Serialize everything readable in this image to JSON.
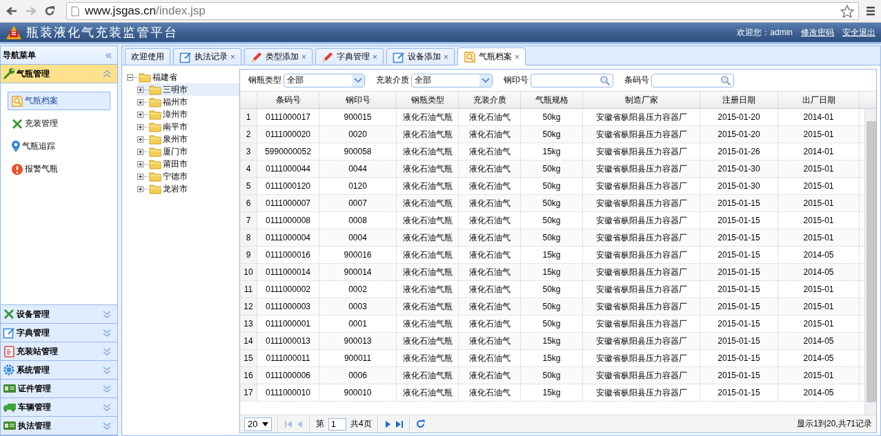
{
  "browser": {
    "url_host": "www.jsgas.cn",
    "url_path": "/index.jsp"
  },
  "header": {
    "title": "瓶装液化气充装监管平台",
    "welcome": "欢迎您：admin",
    "links": [
      "修改密码",
      "安全退出"
    ]
  },
  "sidebar": {
    "title": "导航菜单",
    "collapse": "«",
    "sections": [
      {
        "label": "气瓶管理",
        "expanded": true,
        "items": [
          {
            "label": "气瓶档案",
            "selected": true
          },
          {
            "label": "充装管理",
            "selected": false
          },
          {
            "label": "气瓶追踪",
            "selected": false
          },
          {
            "label": "报警气瓶",
            "selected": false
          }
        ]
      },
      {
        "label": "设备管理",
        "expanded": false
      },
      {
        "label": "字典管理",
        "expanded": false
      },
      {
        "label": "充装站管理",
        "expanded": false
      },
      {
        "label": "系统管理",
        "expanded": false
      },
      {
        "label": "证件管理",
        "expanded": false
      },
      {
        "label": "车辆管理",
        "expanded": false
      },
      {
        "label": "执法管理",
        "expanded": false
      }
    ]
  },
  "tabs": [
    {
      "label": "欢迎使用",
      "selected": false
    },
    {
      "label": "执法记录",
      "close": "×",
      "selected": false
    },
    {
      "label": "类型添加",
      "close": "×",
      "selected": false
    },
    {
      "label": "字典管理",
      "close": "×",
      "selected": false
    },
    {
      "label": "设备添加",
      "close": "×",
      "selected": false
    },
    {
      "label": "气瓶档案",
      "close": "×",
      "selected": true
    }
  ],
  "tree": {
    "label": "福建省",
    "expanded": true,
    "children": [
      {
        "label": "三明市",
        "expanded": false,
        "selected": true
      },
      {
        "label": "福州市",
        "expanded": false,
        "selected": false
      },
      {
        "label": "漳州市",
        "expanded": false,
        "selected": false
      },
      {
        "label": "南平市",
        "expanded": false,
        "selected": false
      },
      {
        "label": "泉州市",
        "expanded": false,
        "selected": false
      },
      {
        "label": "厦门市",
        "expanded": false,
        "selected": false
      },
      {
        "label": "莆田市",
        "expanded": false,
        "selected": false
      },
      {
        "label": "宁德市",
        "expanded": false,
        "selected": false
      },
      {
        "label": "龙岩市",
        "expanded": false,
        "selected": false
      }
    ]
  },
  "filters": [
    {
      "kind": "select",
      "label": "钢瓶类型",
      "value": "全部"
    },
    {
      "kind": "select",
      "label": "充装介质",
      "value": "全部"
    },
    {
      "kind": "search",
      "label": "钢印号"
    },
    {
      "kind": "search",
      "label": "条码号"
    }
  ],
  "table": {
    "columns": [
      "条码号",
      "钢印号",
      "钢瓶类型",
      "充装介质",
      "气瓶规格",
      "制造厂家",
      "注册日期",
      "出厂日期"
    ],
    "rows": [
      {
        "n": "1",
        "cells": [
          "0111000017",
          "900015",
          "液化石油气瓶",
          "液化石油气",
          "50kg",
          "安徽省枞阳县压力容器厂",
          "2015-01-20",
          "2014-01"
        ]
      },
      {
        "n": "2",
        "cells": [
          "0111000020",
          "0020",
          "液化石油气瓶",
          "液化石油气",
          "50kg",
          "安徽省枞阳县压力容器厂",
          "2015-01-20",
          "2015-01"
        ]
      },
      {
        "n": "3",
        "cells": [
          "5990000052",
          "900058",
          "液化石油气瓶",
          "液化石油气",
          "15kg",
          "安徽省枞阳县压力容器厂",
          "2015-01-26",
          "2014-01"
        ]
      },
      {
        "n": "4",
        "cells": [
          "0111000044",
          "0044",
          "液化石油气瓶",
          "液化石油气",
          "50kg",
          "安徽省枞阳县压力容器厂",
          "2015-01-30",
          "2015-01"
        ]
      },
      {
        "n": "5",
        "cells": [
          "0111000120",
          "0120",
          "液化石油气瓶",
          "液化石油气",
          "50kg",
          "安徽省枞阳县压力容器厂",
          "2015-01-30",
          "2015-01"
        ]
      },
      {
        "n": "6",
        "cells": [
          "0111000007",
          "0007",
          "液化石油气瓶",
          "液化石油气",
          "50kg",
          "安徽省枞阳县压力容器厂",
          "2015-01-15",
          "2015-01"
        ]
      },
      {
        "n": "7",
        "cells": [
          "0111000008",
          "0008",
          "液化石油气瓶",
          "液化石油气",
          "50kg",
          "安徽省枞阳县压力容器厂",
          "2015-01-15",
          "2015-01"
        ]
      },
      {
        "n": "8",
        "cells": [
          "0111000004",
          "0004",
          "液化石油气瓶",
          "液化石油气",
          "50kg",
          "安徽省枞阳县压力容器厂",
          "2015-01-15",
          "2015-01"
        ]
      },
      {
        "n": "9",
        "cells": [
          "0111000016",
          "900016",
          "液化石油气瓶",
          "液化石油气",
          "15kg",
          "安徽省枞阳县压力容器厂",
          "2015-01-15",
          "2014-05"
        ]
      },
      {
        "n": "10",
        "cells": [
          "0111000014",
          "900014",
          "液化石油气瓶",
          "液化石油气",
          "15kg",
          "安徽省枞阳县压力容器厂",
          "2015-01-15",
          "2014-05"
        ]
      },
      {
        "n": "11",
        "cells": [
          "0111000002",
          "0002",
          "液化石油气瓶",
          "液化石油气",
          "50kg",
          "安徽省枞阳县压力容器厂",
          "2015-01-15",
          "2015-01"
        ]
      },
      {
        "n": "12",
        "cells": [
          "0111000003",
          "0003",
          "液化石油气瓶",
          "液化石油气",
          "50kg",
          "安徽省枞阳县压力容器厂",
          "2015-01-15",
          "2015-01"
        ]
      },
      {
        "n": "13",
        "cells": [
          "0111000001",
          "0001",
          "液化石油气瓶",
          "液化石油气",
          "50kg",
          "安徽省枞阳县压力容器厂",
          "2015-01-15",
          "2015-01"
        ]
      },
      {
        "n": "14",
        "cells": [
          "0111000013",
          "900013",
          "液化石油气瓶",
          "液化石油气",
          "15kg",
          "安徽省枞阳县压力容器厂",
          "2015-01-15",
          "2014-05"
        ]
      },
      {
        "n": "15",
        "cells": [
          "0111000011",
          "900011",
          "液化石油气瓶",
          "液化石油气",
          "15kg",
          "安徽省枞阳县压力容器厂",
          "2015-01-15",
          "2014-05"
        ]
      },
      {
        "n": "16",
        "cells": [
          "0111000006",
          "0006",
          "液化石油气瓶",
          "液化石油气",
          "50kg",
          "安徽省枞阳县压力容器厂",
          "2015-01-15",
          "2015-01"
        ]
      },
      {
        "n": "17",
        "cells": [
          "0111000010",
          "900010",
          "液化石油气瓶",
          "液化石油气",
          "15kg",
          "安徽省枞阳县压力容器厂",
          "2015-01-15",
          "2014-05"
        ]
      }
    ]
  },
  "pager": {
    "page_size": "20",
    "page_prefix": "第",
    "page": "1",
    "total_pages": "共4页",
    "info": "显示1到20,共71记录"
  }
}
